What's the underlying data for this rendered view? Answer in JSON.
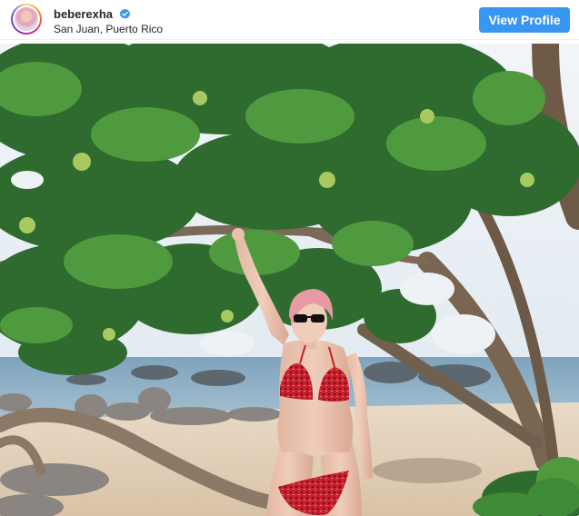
{
  "post": {
    "username": "beberexha",
    "location": "San Juan, Puerto Rico",
    "verified": true,
    "view_profile_label": "View Profile"
  },
  "icons": {
    "verified_badge": "verified-badge-icon",
    "avatar": "profile-avatar"
  },
  "colors": {
    "button_blue": "#3897f0",
    "verified_blue": "#3897f0",
    "text_dark": "#262626"
  }
}
